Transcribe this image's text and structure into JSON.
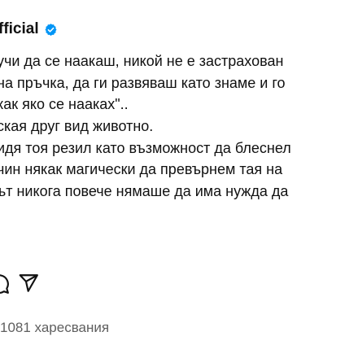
{
  "post": {
    "username": "fficial",
    "verified_icon": "verified-badge-icon",
    "caption_lines": [
      "учи да се наакаш, никой не е застрахован",
      "на пръчка, да ги развяваш като знаме и го",
      "как яко се наакаx\"..",
      "ская друг вид животно.",
      "идя тоя резил като възможност да блеснел",
      "чин някак магически да превърнем тая на",
      "ът никога повече нямаше да има нужда да"
    ],
    "likes_text": "1081 харесвания"
  },
  "icons": {
    "comment": "comment-icon",
    "share": "share-icon"
  },
  "colors": {
    "text": "#111111",
    "muted": "#5f5f5f",
    "verified": "#0095f6"
  }
}
